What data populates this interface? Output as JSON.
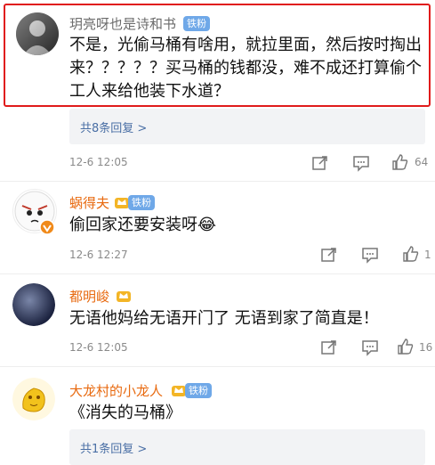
{
  "comments": [
    {
      "username": "玥亮呀也是诗和书",
      "badge": "铁粉",
      "text": "不是，光偷马桶有啥用，就拉里面，然后按时掏出来？？？？？买马桶的钱都没，难不成还打算偷个工人来给他装下水道？",
      "replies_label": "共8条回复 >",
      "time": "12-6 12:05",
      "likes": "64"
    },
    {
      "username": "蜗得夫",
      "badge": "铁粉",
      "text": "偷回家还要安装呀😂",
      "time": "12-6 12:27",
      "likes": "1"
    },
    {
      "username": "都明峻",
      "text": "无语他妈给无语开门了 无语到家了简直是！",
      "time": "12-6 12:05",
      "likes": "16"
    },
    {
      "username": "大龙村的小龙人",
      "badge": "铁粉",
      "text": "《消失的马桶》",
      "replies_label": "共1条回复 >"
    }
  ],
  "icons": {
    "share": "share-icon",
    "comment": "comment-icon",
    "like": "thumbs-up-icon"
  },
  "colors": {
    "username_orange": "#e86a10",
    "badge_blue": "#6fa8e8",
    "highlight_red": "#e01b1b",
    "replies_bg": "#f2f3f5"
  }
}
